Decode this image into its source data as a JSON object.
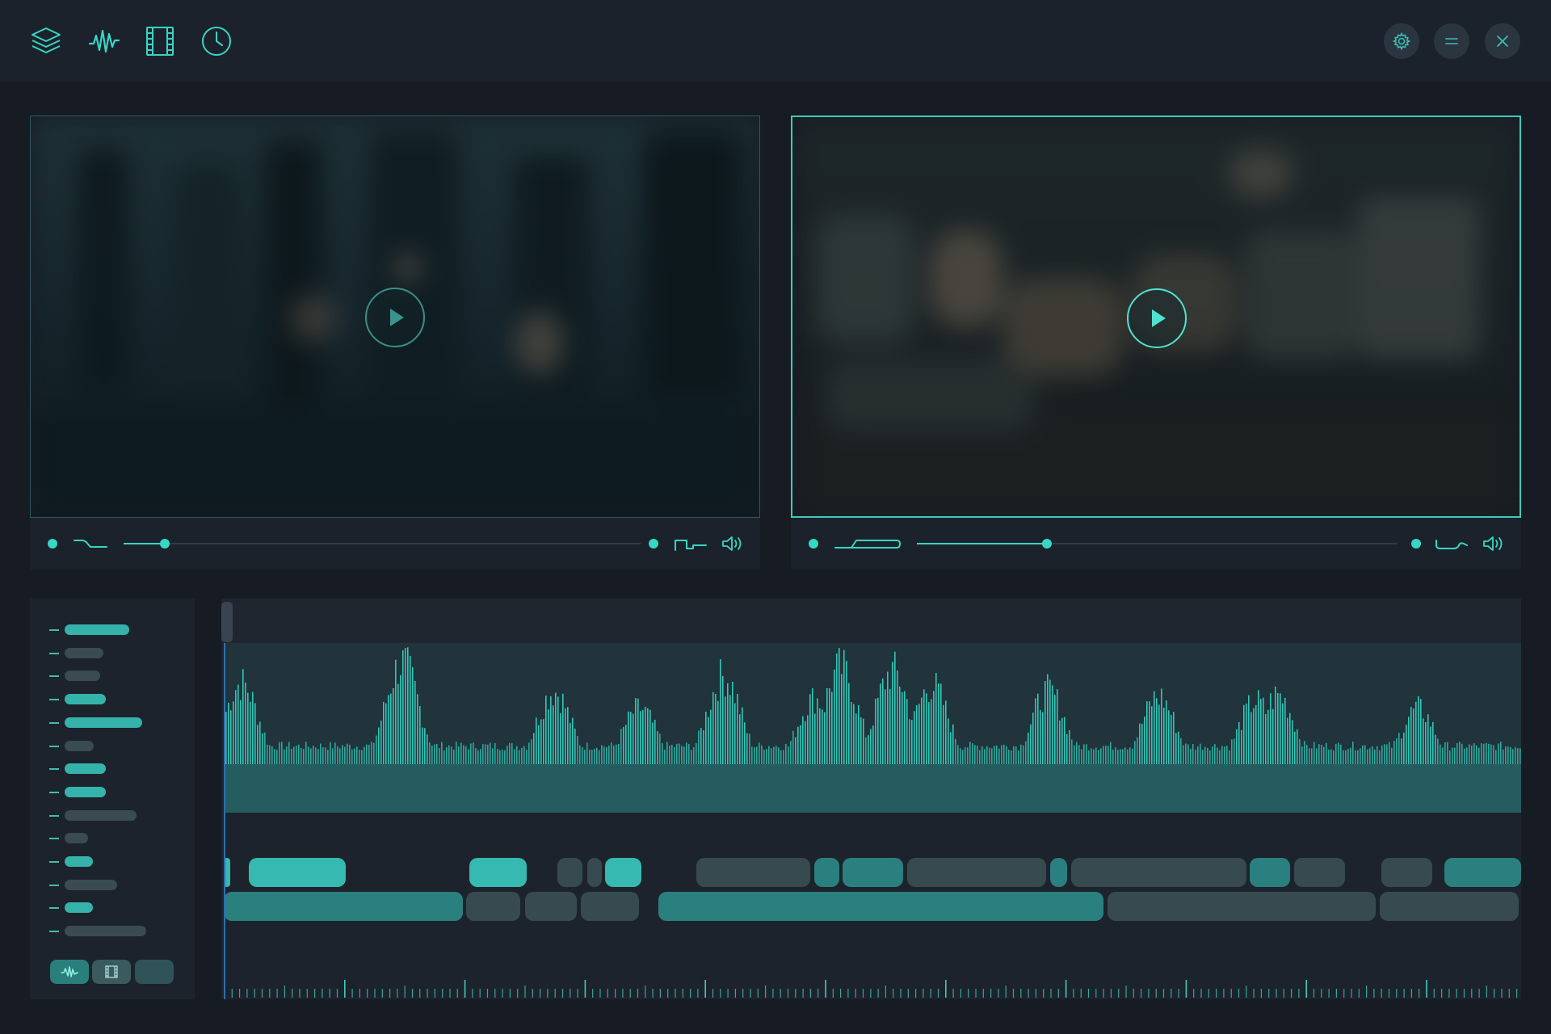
{
  "app": {
    "toolbar_icons": [
      "layers-icon",
      "waveform-icon",
      "film-icon",
      "clock-icon"
    ],
    "window_controls": [
      "settings-icon",
      "minimize-icon",
      "close-icon"
    ]
  },
  "colors": {
    "accent": "#37d6c5",
    "accent_bright": "#4fe3cf",
    "background": "#161b24",
    "panel": "#1d232c",
    "topbar": "#1c222c",
    "clip_bright": "#35b9b1",
    "clip_mid": "#2a807e",
    "clip_dark": "#364a4f"
  },
  "viewers": [
    {
      "id": "left",
      "state": "inactive",
      "play_icon": "play-icon",
      "progress": 0.08,
      "volume_icon": "speaker-icon"
    },
    {
      "id": "right",
      "state": "active",
      "play_icon": "play-icon",
      "progress": 0.27,
      "volume_icon": "speaker-icon"
    }
  ],
  "timeline": {
    "layer_rows": [
      {
        "width": 0.53,
        "tone": "bright"
      },
      {
        "width": 0.32,
        "tone": "dim"
      },
      {
        "width": 0.29,
        "tone": "dim"
      },
      {
        "width": 0.34,
        "tone": "bright"
      },
      {
        "width": 0.64,
        "tone": "bright"
      },
      {
        "width": 0.24,
        "tone": "dim"
      },
      {
        "width": 0.34,
        "tone": "bright"
      },
      {
        "width": 0.34,
        "tone": "bright"
      },
      {
        "width": 0.59,
        "tone": "dim"
      },
      {
        "width": 0.19,
        "tone": "dim"
      },
      {
        "width": 0.23,
        "tone": "bright"
      },
      {
        "width": 0.43,
        "tone": "dim"
      },
      {
        "width": 0.23,
        "tone": "bright"
      },
      {
        "width": 0.67,
        "tone": "dim"
      }
    ],
    "mode_buttons": [
      "waveform-icon",
      "film-icon",
      "blank"
    ],
    "playhead_position": 0.0,
    "video_track": [
      {
        "start": 0.0,
        "end": 0.005,
        "tone": "bright"
      },
      {
        "start": 0.019,
        "end": 0.094,
        "tone": "bright"
      },
      {
        "start": 0.189,
        "end": 0.233,
        "tone": "bright"
      },
      {
        "start": 0.257,
        "end": 0.276,
        "tone": "dark"
      },
      {
        "start": 0.28,
        "end": 0.291,
        "tone": "dark"
      },
      {
        "start": 0.294,
        "end": 0.322,
        "tone": "bright"
      },
      {
        "start": 0.364,
        "end": 0.452,
        "tone": "dark"
      },
      {
        "start": 0.455,
        "end": 0.474,
        "tone": "mid"
      },
      {
        "start": 0.477,
        "end": 0.524,
        "tone": "mid"
      },
      {
        "start": 0.527,
        "end": 0.634,
        "tone": "dark"
      },
      {
        "start": 0.637,
        "end": 0.65,
        "tone": "mid"
      },
      {
        "start": 0.653,
        "end": 0.788,
        "tone": "dark"
      },
      {
        "start": 0.791,
        "end": 0.822,
        "tone": "mid"
      },
      {
        "start": 0.825,
        "end": 0.864,
        "tone": "dark"
      },
      {
        "start": 0.892,
        "end": 0.931,
        "tone": "dark"
      },
      {
        "start": 0.941,
        "end": 1.0,
        "tone": "mid"
      }
    ],
    "audio_track": [
      {
        "start": 0.0,
        "end": 0.184,
        "tone": "mid"
      },
      {
        "start": 0.187,
        "end": 0.229,
        "tone": "dark"
      },
      {
        "start": 0.232,
        "end": 0.272,
        "tone": "dark"
      },
      {
        "start": 0.275,
        "end": 0.32,
        "tone": "dark"
      },
      {
        "start": 0.335,
        "end": 0.678,
        "tone": "mid"
      },
      {
        "start": 0.681,
        "end": 0.888,
        "tone": "dark"
      },
      {
        "start": 0.891,
        "end": 0.998,
        "tone": "dark"
      }
    ],
    "waveform_peaks": [
      {
        "pos": 0.013,
        "amp": 0.8
      },
      {
        "pos": 0.137,
        "amp": 1.0
      },
      {
        "pos": 0.254,
        "amp": 0.72
      },
      {
        "pos": 0.32,
        "amp": 0.55
      },
      {
        "pos": 0.385,
        "amp": 0.87
      },
      {
        "pos": 0.455,
        "amp": 0.65
      },
      {
        "pos": 0.475,
        "amp": 0.95
      },
      {
        "pos": 0.515,
        "amp": 0.92
      },
      {
        "pos": 0.545,
        "amp": 0.78
      },
      {
        "pos": 0.635,
        "amp": 0.72
      },
      {
        "pos": 0.72,
        "amp": 0.67
      },
      {
        "pos": 0.795,
        "amp": 0.62
      },
      {
        "pos": 0.812,
        "amp": 0.68
      },
      {
        "pos": 0.92,
        "amp": 0.55
      }
    ]
  }
}
